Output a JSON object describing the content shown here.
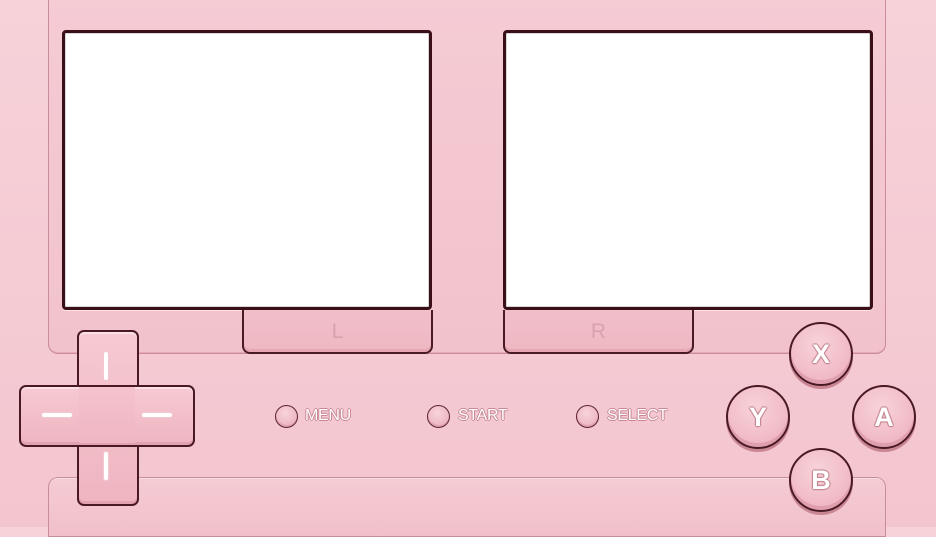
{
  "controller": {
    "shoulder_left_label": "L",
    "shoulder_right_label": "R",
    "menu_label": "MENU",
    "start_label": "START",
    "select_label": "SELECT",
    "face_buttons": {
      "x": "X",
      "y": "Y",
      "a": "A",
      "b": "B"
    },
    "dpad_icon": "dpad-icon"
  },
  "colors": {
    "body": "#f3c5cf",
    "outline": "#4a1a24",
    "screen": "#ffffff",
    "label_text": "#ffffff",
    "shoulder_text": "#d9a3ae"
  }
}
